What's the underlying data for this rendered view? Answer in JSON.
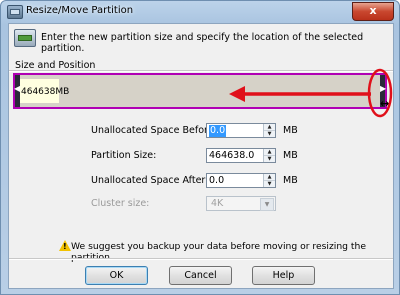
{
  "window": {
    "title": "Resize/Move Partition",
    "close_glyph": "x"
  },
  "header": {
    "icon": "disk-partition-icon",
    "instruction": "Enter the new partition size and specify the location of the selected partition."
  },
  "group": {
    "label": "Size and Position",
    "partition_label": "464638MB",
    "used_fraction": 0.11,
    "bar_color": "#b000b4",
    "annotation_color": "#e0101a"
  },
  "fields": {
    "unallocated_before": {
      "label": "Unallocated Space Before:",
      "value": "0.0",
      "unit": "MB"
    },
    "partition_size": {
      "label": "Partition Size:",
      "value": "464638.0",
      "unit": "MB"
    },
    "unallocated_after": {
      "label": "Unallocated Space After:",
      "value": "0.0",
      "unit": "MB"
    },
    "cluster_size": {
      "label": "Cluster size:",
      "value": "4K"
    }
  },
  "warning": {
    "icon": "warning-icon",
    "text": "We suggest you backup your data before moving or resizing the partition."
  },
  "buttons": {
    "ok": "OK",
    "cancel": "Cancel",
    "help": "Help"
  }
}
